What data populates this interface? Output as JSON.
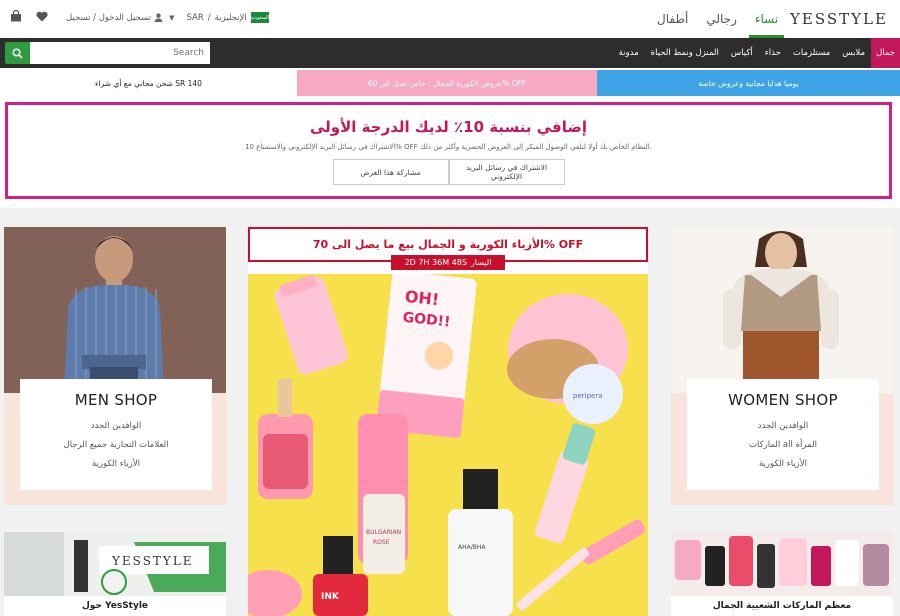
{
  "header": {
    "logo": "YESSTYLE",
    "gender_tabs": [
      "نساء",
      "رجالي",
      "أطفال"
    ],
    "account_text": "تسجيل الدخول / تسجيل",
    "currency": "SAR",
    "language": "الإنجليزية",
    "flag_text": "السعودية"
  },
  "nav": {
    "search_placeholder": "Search",
    "categories": [
      "جمال",
      "ملابس",
      "مستلزمات",
      "حذاء",
      "أكياس",
      "المنزل ونمط الحياة",
      "مدونة"
    ]
  },
  "promos": {
    "shipping": "شحن مجاني مع أي شراء SR 140",
    "korea_beauty": "عروض الكورية الجمال ؛ خاص تصل الى 60% OFF",
    "daily_gifts": "يوميا هدايا مجانية وعروض خاصة"
  },
  "subscribe": {
    "title": "إضافي بنسبة 10٪ لديك الدرجة الأولى",
    "description": "الاشتراك في رسائل البريد الإلكتروني والاستمتاع 10% OFF النظام الخاص بك أولا لتلقي الوصول المبكر إلى العروض الحصرية وأكثر من ذلك.",
    "btn_subscribe": "الاشتراك في رسائل البريد الإلكتروني",
    "btn_share": "مشاركة هذا العرض"
  },
  "men_shop": {
    "title": "MEN SHOP",
    "links": [
      "الوافدين الجدد",
      "العلامات التجارية جميع الرجال",
      "الأزياء الكورية"
    ]
  },
  "women_shop": {
    "title": "WOMEN SHOP",
    "links": [
      "الوافدين الجدد",
      "الماركات all المرأة",
      "الأزياء الكورية"
    ]
  },
  "sale": {
    "headline": "الأزياء الكورية و الجمال بيع ما يصل الى 70% OFF",
    "timer_value": "2D 7H 36M 48S",
    "timer_label": "اليسار"
  },
  "bottom": {
    "left_caption": "حول YesStyle",
    "right_caption": "معظم الماركات الشعبية الجمال",
    "yesstyle_sign": "YESSTYLE"
  },
  "colors": {
    "accent_green": "#2e9c3f",
    "sale_red": "#c8102e",
    "pink_border": "#d21f8c",
    "nav_dark": "#2d2d2d"
  }
}
